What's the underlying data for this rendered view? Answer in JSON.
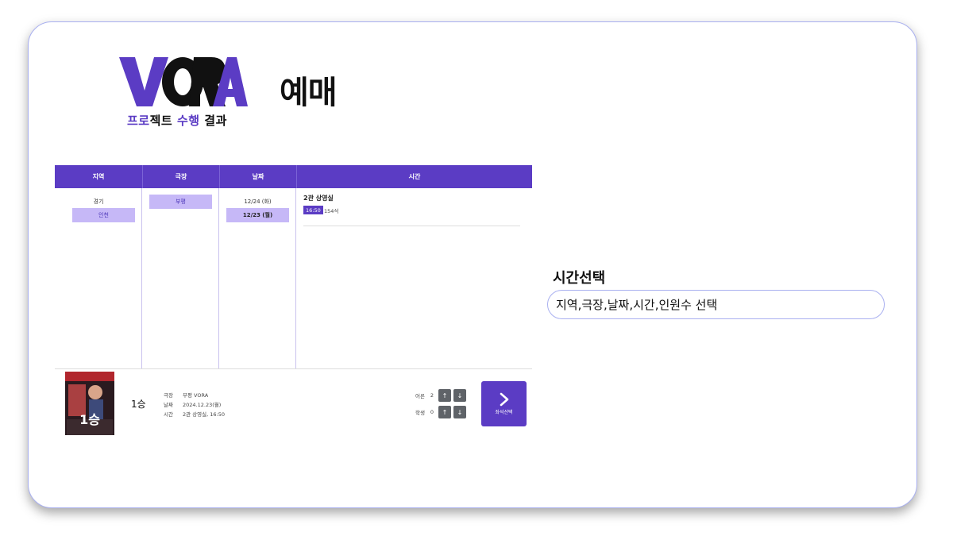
{
  "logo": {
    "wordmark": "VORA",
    "subtitle_purple_1": "프로",
    "subtitle_black_1": "젝트",
    "subtitle_purple_2": "수행",
    "subtitle_black_2": "결과"
  },
  "page_title": "예매",
  "booking": {
    "headers": {
      "region": "지역",
      "theater": "극장",
      "date": "날짜",
      "time": "시간"
    },
    "regions": [
      "경기",
      "인천"
    ],
    "selected_region": "인천",
    "theaters": [
      "부평"
    ],
    "dates": [
      "12/24 (화)",
      "12/23 (월)"
    ],
    "screen": "2관 상영실",
    "showtime": "16:50",
    "seats": "154석"
  },
  "summary": {
    "poster_text": "1승",
    "movie_title": "1승",
    "info": [
      {
        "key": "극장",
        "value": "부평 VORA"
      },
      {
        "key": "날짜",
        "value": "2024.12.23(월)"
      },
      {
        "key": "시간",
        "value": "2관 상영실, 16:50"
      }
    ],
    "adult_label": "어른",
    "adult_count": "2",
    "student_label": "학생",
    "student_count": "0",
    "seat_button_label": "좌석선택"
  },
  "side": {
    "section_title": "시간선택",
    "description": "지역,극장,날짜,시간,인원수 선택"
  },
  "colors": {
    "accent": "#5b3cc4",
    "chip": "#c6b8f7",
    "border": "#a9b0f0"
  }
}
